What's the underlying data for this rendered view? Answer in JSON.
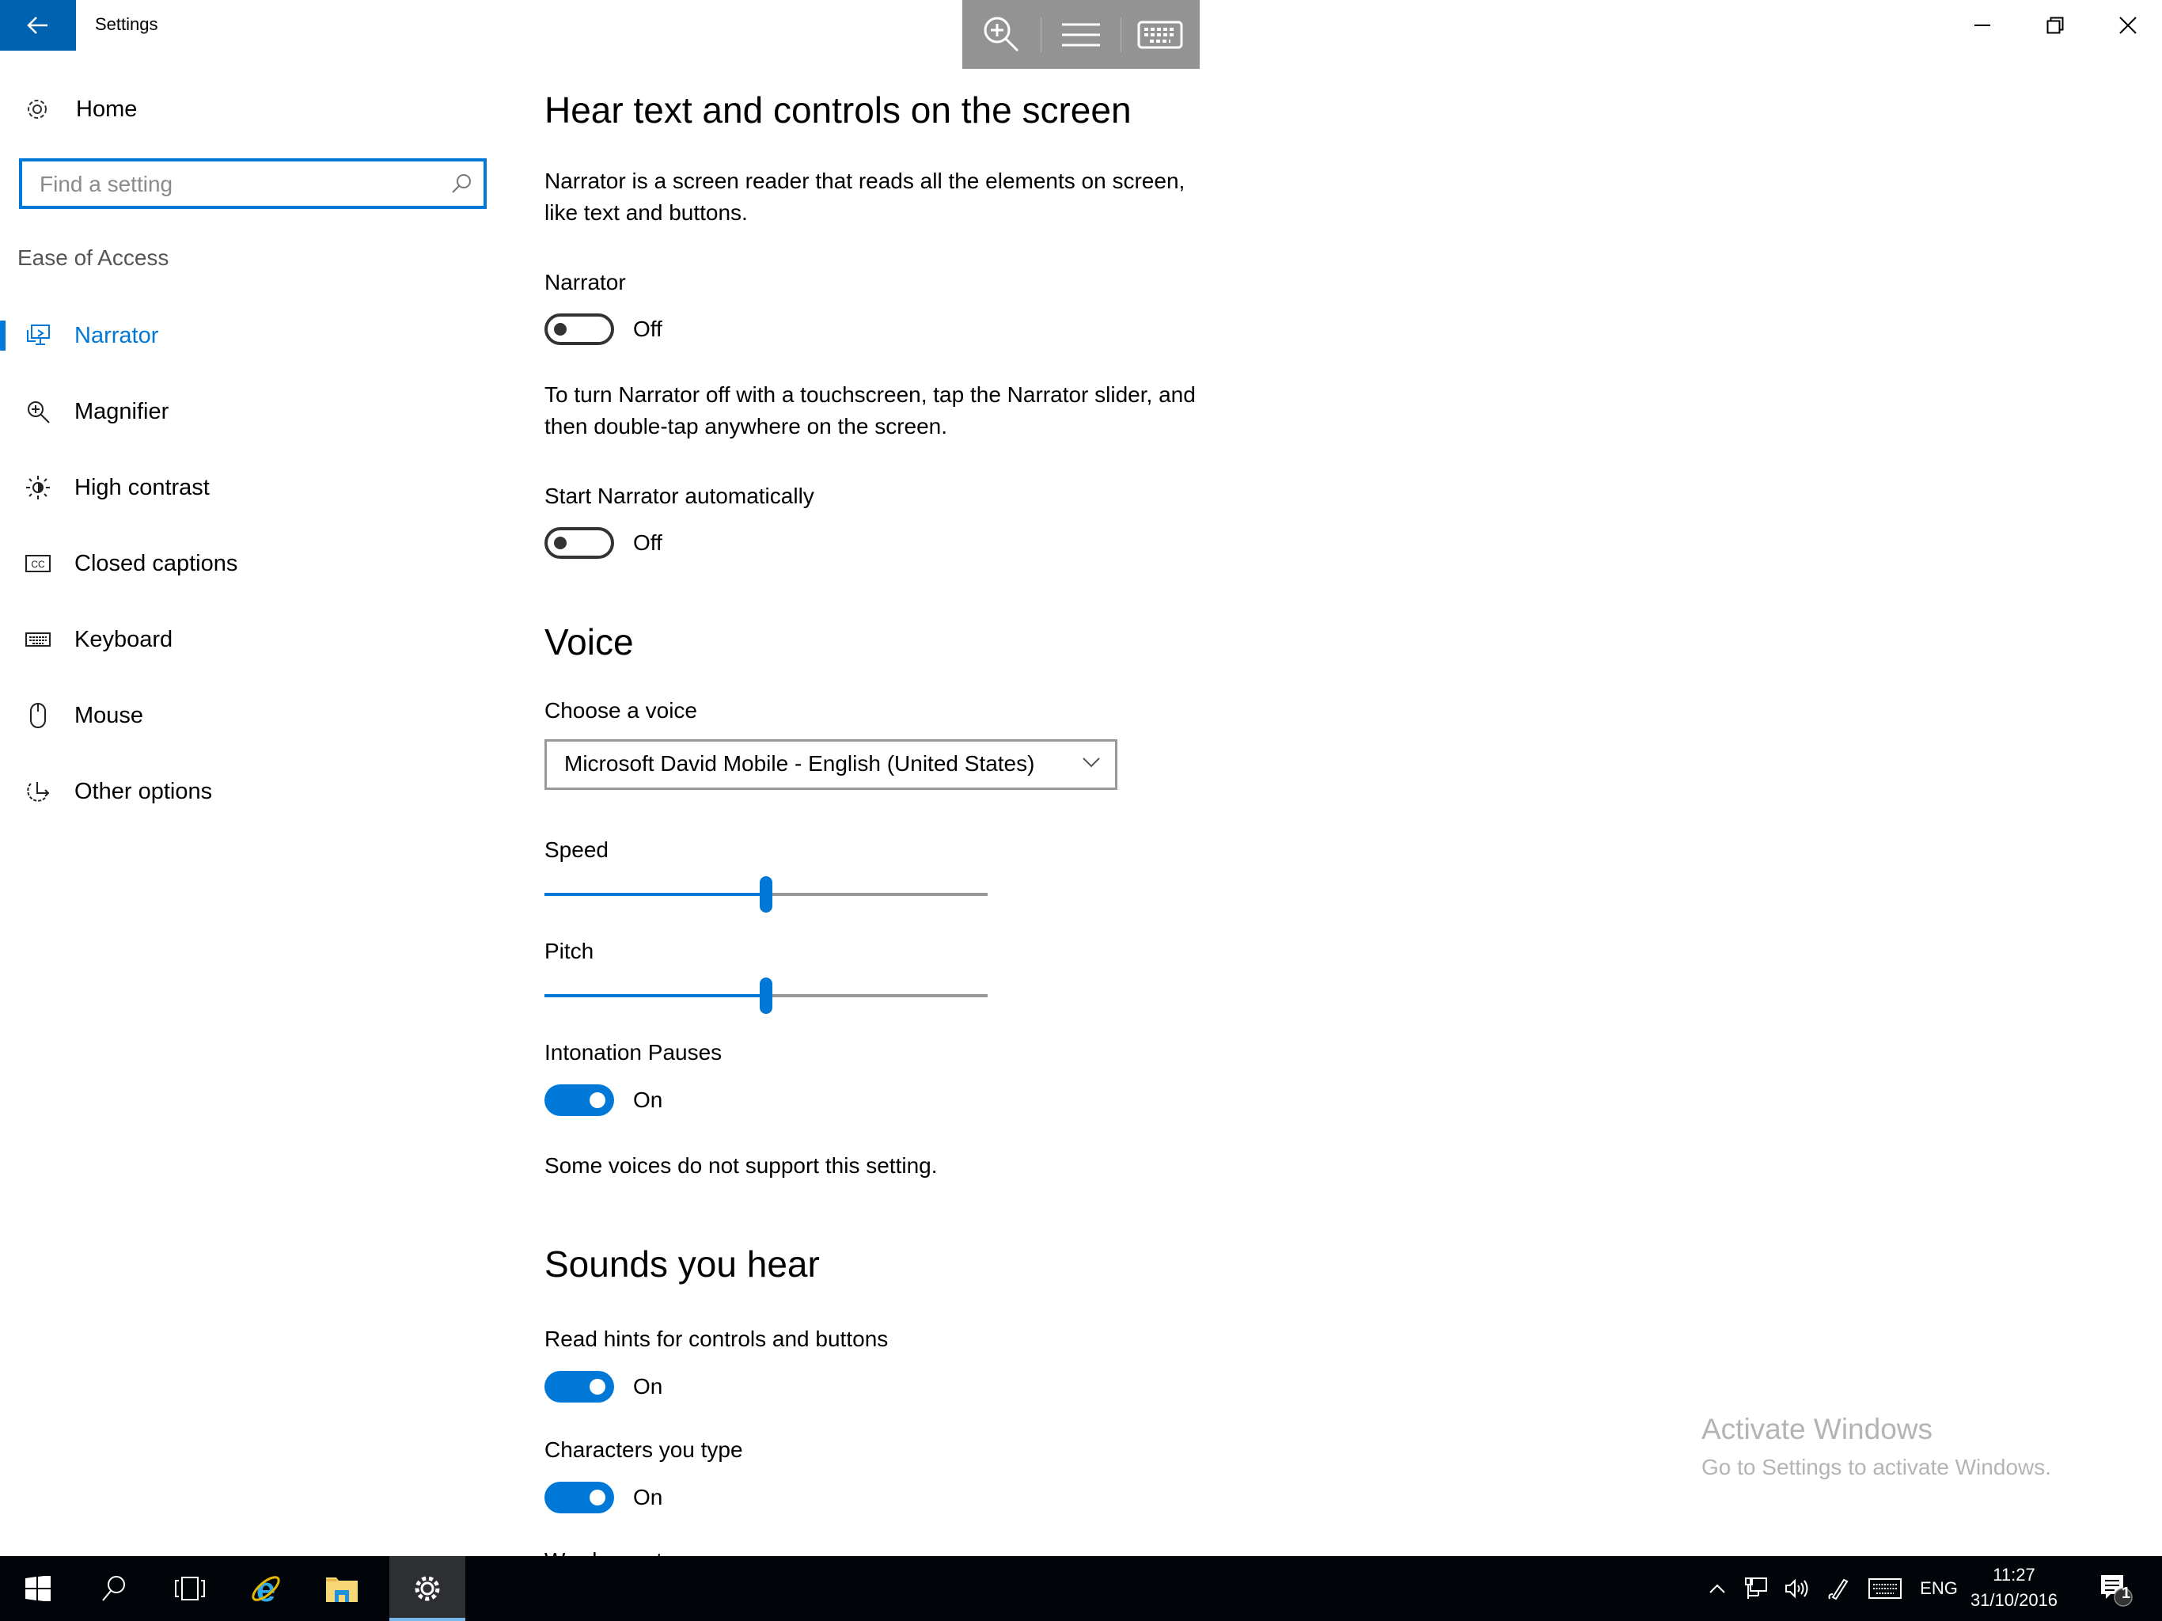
{
  "window": {
    "title": "Settings",
    "controls": {
      "minimize": "minimize-icon",
      "restore": "restore-icon",
      "close": "close-icon"
    }
  },
  "touch_toolbar": {
    "items": [
      "zoom-in-icon",
      "menu-icon",
      "keyboard-icon"
    ]
  },
  "sidebar": {
    "home_label": "Home",
    "search": {
      "value": "",
      "placeholder": "Find a setting"
    },
    "section_title": "Ease of Access",
    "items": [
      {
        "label": "Narrator",
        "icon": "narrator-icon",
        "active": true
      },
      {
        "label": "Magnifier",
        "icon": "magnifier-icon",
        "active": false
      },
      {
        "label": "High contrast",
        "icon": "high-contrast-icon",
        "active": false
      },
      {
        "label": "Closed captions",
        "icon": "closed-captions-icon",
        "active": false
      },
      {
        "label": "Keyboard",
        "icon": "keyboard-icon",
        "active": false
      },
      {
        "label": "Mouse",
        "icon": "mouse-icon",
        "active": false
      },
      {
        "label": "Other options",
        "icon": "other-options-icon",
        "active": false
      }
    ]
  },
  "main": {
    "heading": "Hear text and controls on the screen",
    "intro_line1": "Narrator is a screen reader that reads all the elements on screen,",
    "intro_line2": "like text and buttons.",
    "narrator": {
      "label": "Narrator",
      "state": "Off",
      "on": false
    },
    "touch_hint_line1": "To turn Narrator off with a touchscreen, tap the Narrator slider, and",
    "touch_hint_line2": "then double-tap anywhere on the screen.",
    "start_auto": {
      "label": "Start Narrator automatically",
      "state": "Off",
      "on": false
    },
    "voice_heading": "Voice",
    "choose_voice_label": "Choose a voice",
    "voice_selected": "Microsoft David Mobile - English (United States)",
    "speed": {
      "label": "Speed",
      "value_percent": 50
    },
    "pitch": {
      "label": "Pitch",
      "value_percent": 50
    },
    "intonation": {
      "label": "Intonation Pauses",
      "state": "On",
      "on": true
    },
    "intonation_note": "Some voices do not support this setting.",
    "sounds_heading": "Sounds you hear",
    "read_hints": {
      "label": "Read hints for controls and buttons",
      "state": "On",
      "on": true
    },
    "chars_typed": {
      "label": "Characters you type",
      "state": "On",
      "on": true
    },
    "words_typed_label": "Words you type"
  },
  "watermark": {
    "title": "Activate Windows",
    "subtitle": "Go to Settings to activate Windows."
  },
  "taskbar": {
    "apps": [
      "start-icon",
      "search-icon",
      "task-view-icon",
      "internet-explorer-icon",
      "file-explorer-icon",
      "settings-icon"
    ],
    "language": "ENG",
    "time": "11:27",
    "date": "31/10/2016",
    "notification_count": "1"
  },
  "colors": {
    "accent": "#0078d7",
    "back_button": "#0063b1",
    "taskbar": "#010409",
    "touch_toolbar": "#939393"
  }
}
